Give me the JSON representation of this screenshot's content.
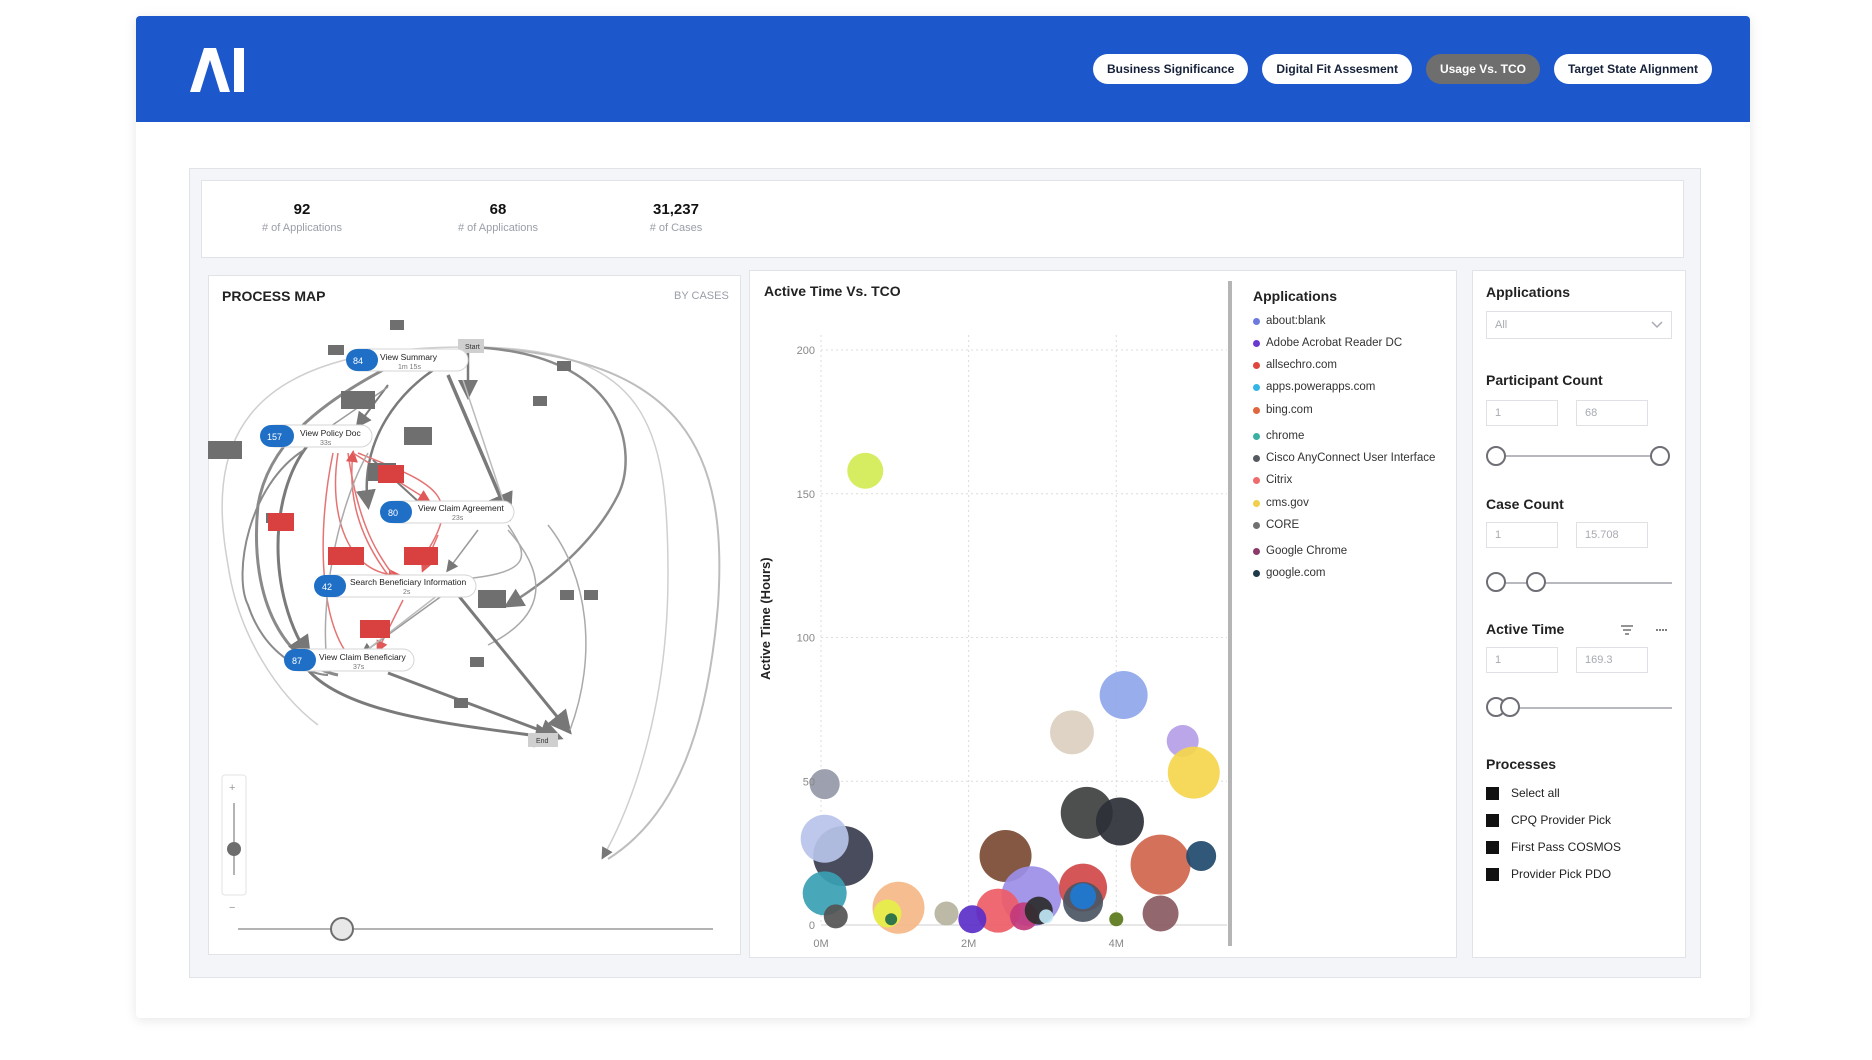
{
  "header": {
    "logo_text": "AI",
    "tabs": [
      {
        "label": "Business Significance",
        "active": false
      },
      {
        "label": "Digital Fit Assesment",
        "active": false
      },
      {
        "label": "Usage Vs. TCO",
        "active": true
      },
      {
        "label": "Target State Alignment",
        "active": false
      }
    ],
    "brand_color": "#1d57cc"
  },
  "stats": [
    {
      "value": "92",
      "label": "# of Applications"
    },
    {
      "value": "68",
      "label": "# of Applications"
    },
    {
      "value": "31,237",
      "label": "# of Cases"
    }
  ],
  "process_map": {
    "title": "PROCESS MAP",
    "mode": "BY CASES",
    "zoom_in": "+",
    "zoom_out": "−",
    "start_label": "Start",
    "end_label": "End",
    "nodes": [
      {
        "count": "84",
        "name": "View Summary",
        "time": "1m 15s"
      },
      {
        "count": "157",
        "name": "View Policy Doc",
        "time": "33s"
      },
      {
        "count": "80",
        "name": "View Claim Agreement",
        "time": "23s"
      },
      {
        "count": "42",
        "name": "Search Beneficiary Information",
        "time": "2s"
      },
      {
        "count": "87",
        "name": "View Claim Beneficiary",
        "time": "37s"
      }
    ]
  },
  "chart_data": {
    "type": "scatter",
    "title": "Active Time Vs. TCO",
    "xlabel": "",
    "ylabel": "Active Time (Hours)",
    "x_ticks": [
      "0M",
      "2M",
      "4M"
    ],
    "y_ticks": [
      "0",
      "50",
      "100",
      "150",
      "200"
    ],
    "xlim": [
      0,
      5.5
    ],
    "ylim": [
      0,
      200
    ],
    "grid": true,
    "legend_position": "right",
    "points": [
      {
        "x": 0.6,
        "y": 158,
        "r": 18,
        "color": "#d4ec54"
      },
      {
        "x": 4.1,
        "y": 80,
        "r": 24,
        "color": "#8ea6ea"
      },
      {
        "x": 3.4,
        "y": 67,
        "r": 22,
        "color": "#dccfc0"
      },
      {
        "x": 4.9,
        "y": 64,
        "r": 16,
        "color": "#b59ee8"
      },
      {
        "x": 5.05,
        "y": 53,
        "r": 26,
        "color": "#f5d64c"
      },
      {
        "x": 0.05,
        "y": 49,
        "r": 15,
        "color": "#9598a8"
      },
      {
        "x": 3.6,
        "y": 39,
        "r": 26,
        "color": "#3e403f"
      },
      {
        "x": 4.05,
        "y": 36,
        "r": 24,
        "color": "#2c3036"
      },
      {
        "x": 0.3,
        "y": 24,
        "r": 30,
        "color": "#3a3d4e"
      },
      {
        "x": 0.05,
        "y": 30,
        "r": 24,
        "color": "#b8c3ea"
      },
      {
        "x": 2.5,
        "y": 24,
        "r": 26,
        "color": "#7a4a32"
      },
      {
        "x": 4.6,
        "y": 21,
        "r": 30,
        "color": "#d0654d"
      },
      {
        "x": 5.15,
        "y": 24,
        "r": 15,
        "color": "#1f4a6e"
      },
      {
        "x": 2.85,
        "y": 10,
        "r": 30,
        "color": "#9c8ee8"
      },
      {
        "x": 3.55,
        "y": 13,
        "r": 24,
        "color": "#d04848"
      },
      {
        "x": 0.05,
        "y": 11,
        "r": 22,
        "color": "#3a9fb4"
      },
      {
        "x": 1.05,
        "y": 6,
        "r": 26,
        "color": "#f5b887"
      },
      {
        "x": 2.4,
        "y": 5,
        "r": 22,
        "color": "#ee5c67"
      },
      {
        "x": 3.55,
        "y": 8,
        "r": 20,
        "color": "#4b5563"
      },
      {
        "x": 3.55,
        "y": 10,
        "r": 13,
        "color": "#1d7bd3"
      },
      {
        "x": 4.6,
        "y": 4,
        "r": 18,
        "color": "#8a5a62"
      },
      {
        "x": 0.9,
        "y": 4,
        "r": 14,
        "color": "#e6ef48"
      },
      {
        "x": 1.7,
        "y": 4,
        "r": 12,
        "color": "#b6b3a0"
      },
      {
        "x": 2.05,
        "y": 2,
        "r": 14,
        "color": "#5b2ec8"
      },
      {
        "x": 2.75,
        "y": 3,
        "r": 14,
        "color": "#c23a7c"
      },
      {
        "x": 2.95,
        "y": 5,
        "r": 14,
        "color": "#2c2c2c"
      },
      {
        "x": 0.2,
        "y": 3,
        "r": 12,
        "color": "#545454"
      },
      {
        "x": 0.95,
        "y": 2,
        "r": 6,
        "color": "#1f6b4a"
      },
      {
        "x": 4.0,
        "y": 2,
        "r": 7,
        "color": "#5a7a1a"
      },
      {
        "x": 3.05,
        "y": 3,
        "r": 7,
        "color": "#bfe6f5"
      }
    ]
  },
  "legend": {
    "title": "Applications",
    "items": [
      {
        "label": "about:blank",
        "color": "#6c7ae0"
      },
      {
        "label": "Adobe Acrobat Reader DC",
        "color": "#6a3ad0"
      },
      {
        "label": "allsechro.com",
        "color": "#e0453e"
      },
      {
        "label": "apps.powerapps.com",
        "color": "#33b5e5"
      },
      {
        "label": "bing.com",
        "color": "#e0663e"
      },
      {
        "label": "chrome",
        "color": "#3ab0a0"
      },
      {
        "label": "Cisco AnyConnect User Interface",
        "color": "#555a60"
      },
      {
        "label": "Citrix",
        "color": "#f06b6b"
      },
      {
        "label": "cms.gov",
        "color": "#f0d04a"
      },
      {
        "label": "CORE",
        "color": "#707070"
      },
      {
        "label": "Google Chrome",
        "color": "#8a3a6a"
      },
      {
        "label": "google.com",
        "color": "#1e3a4a"
      }
    ]
  },
  "filters": {
    "applications": {
      "label": "Applications",
      "value": "All"
    },
    "participant_count": {
      "label": "Participant Count",
      "min": "1",
      "max": "68"
    },
    "case_count": {
      "label": "Case Count",
      "min": "1",
      "max": "15.708"
    },
    "active_time": {
      "label": "Active Time",
      "min": "1",
      "max": "169.3",
      "filter_icon": "filter-icon",
      "more_icon": "more-icon"
    },
    "processes": {
      "label": "Processes",
      "items": [
        "Select all",
        "CPQ Provider Pick",
        "First Pass COSMOS",
        "Provider Pick PDO"
      ]
    }
  }
}
